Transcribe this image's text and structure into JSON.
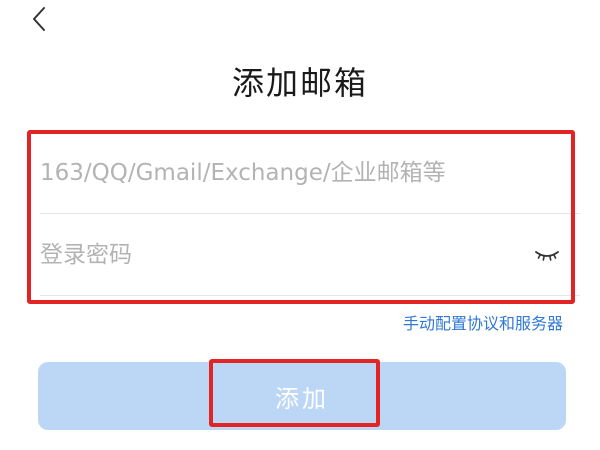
{
  "header": {
    "back_icon": "chevron-left-icon",
    "title": "添加邮箱"
  },
  "form": {
    "email": {
      "value": "",
      "placeholder": "163/QQ/Gmail/Exchange/企业邮箱等"
    },
    "password": {
      "value": "",
      "placeholder": "登录密码",
      "toggle_icon": "eye-closed-icon"
    },
    "manual_config_link": "手动配置协议和服务器",
    "submit_label": "添加"
  },
  "colors": {
    "accent": "#2f78d6",
    "button_disabled_bg": "#bcd6f5",
    "highlight_annotation": "#e32424"
  }
}
